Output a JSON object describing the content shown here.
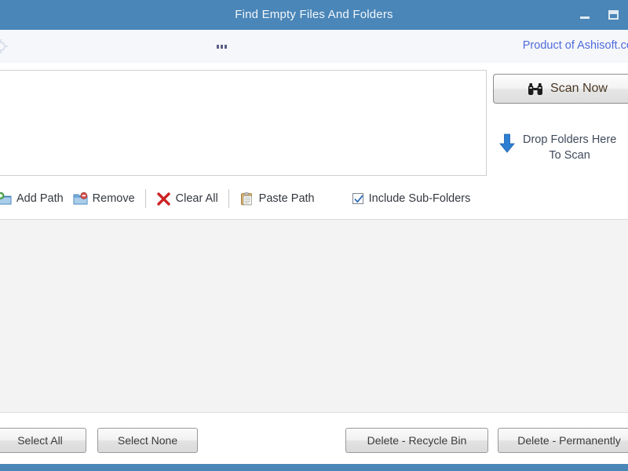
{
  "window": {
    "title": "Find Empty Files And Folders",
    "controls": {
      "minimize": "minimize-button",
      "maximize": "maximize-button"
    }
  },
  "subbar": {
    "ellipsis": "...",
    "brand_link": "Product of Ashisoft.co"
  },
  "path_panel": {
    "list_value": "",
    "list_placeholder": "",
    "scan_button": "Scan Now",
    "drop_zone_line1": "Drop Folders Here",
    "drop_zone_line2": "To Scan"
  },
  "toolbar": {
    "items": [
      {
        "label": "Add Path",
        "icon": "folder-add-icon"
      },
      {
        "label": "Remove",
        "icon": "folder-remove-icon"
      },
      {
        "label": "Clear All",
        "icon": "red-x-icon"
      },
      {
        "label": "Paste Path",
        "icon": "clipboard-icon"
      }
    ],
    "include_subfolders": {
      "label": "Include Sub-Folders",
      "checked": true
    }
  },
  "results": {
    "rows": []
  },
  "bottom_bar": {
    "select_all": "Select All",
    "select_none": "Select None",
    "delete_recycle": "Delete - Recycle Bin",
    "delete_permanently": "Delete - Permanently"
  },
  "colors": {
    "title_bar": "#4a86b8",
    "sub_bar": "#f6f7fb",
    "brand_link": "#4f6bdc",
    "results_bg": "#f3f3f3",
    "status_bar": "#4a86b8",
    "scan_label": "#4a3722",
    "check_mark": "#2f6db5"
  }
}
